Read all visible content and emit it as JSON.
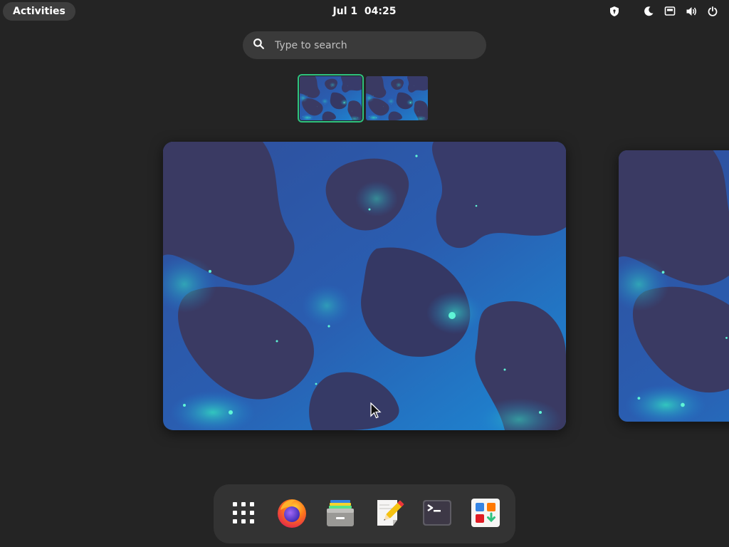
{
  "topbar": {
    "activities_label": "Activities",
    "clock": {
      "date": "Jul 1",
      "time": "04:25"
    },
    "tray_icons": [
      "privacy-shield-icon",
      "night-light-icon",
      "network-wired-icon",
      "volume-icon",
      "power-icon"
    ]
  },
  "search": {
    "placeholder": "Type to search",
    "icon": "search-icon"
  },
  "workspaces": {
    "count": 2,
    "active_index": 0,
    "accent": "#2ec27e"
  },
  "wallpaper": {
    "palette": [
      "#3a3a63",
      "#2d4b9a",
      "#1f7fd0",
      "#33d1c0"
    ]
  },
  "dock": {
    "items": [
      {
        "name": "show-apps",
        "icon": "app-grid-icon"
      },
      {
        "name": "firefox",
        "icon": "firefox-icon"
      },
      {
        "name": "files",
        "icon": "files-icon"
      },
      {
        "name": "text-editor",
        "icon": "text-editor-icon"
      },
      {
        "name": "terminal",
        "icon": "terminal-icon"
      },
      {
        "name": "software",
        "icon": "software-icon"
      }
    ]
  }
}
